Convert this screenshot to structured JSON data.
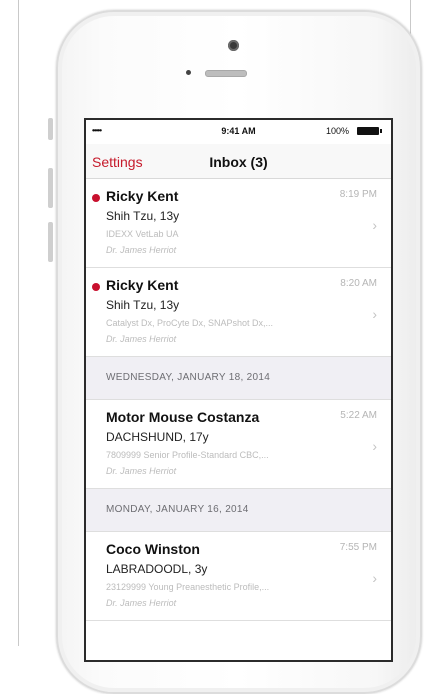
{
  "status_bar": {
    "signal": "•••••",
    "time": "9:41 AM",
    "battery": "100%"
  },
  "nav": {
    "back_label": "Settings",
    "title": "Inbox (3)"
  },
  "messages": [
    {
      "name": "Ricky Kent",
      "breed": "Shih Tzu,  13y",
      "tests": "IDEXX VetLab UA",
      "doctor": "Dr. James Herriot",
      "time": "8:19 PM",
      "unread": true
    },
    {
      "name": "Ricky Kent",
      "breed": "Shih Tzu,  13y",
      "tests": "Catalyst Dx, ProCyte Dx, SNAPshot Dx,...",
      "doctor": "Dr. James Herriot",
      "time": "8:20 AM",
      "unread": true
    },
    {
      "section": "WEDNESDAY, JANUARY 18, 2014",
      "name": "Motor Mouse Costanza",
      "breed": "DACHSHUND,  17y",
      "tests": "7809999 Senior Profile-Standard CBC,...",
      "doctor": "Dr. James Herriot",
      "time": "5:22 AM",
      "unread": false
    },
    {
      "section": "MONDAY, JANUARY 16, 2014",
      "name": "Coco Winston",
      "breed": "LABRADOODL,  3y",
      "tests": "23129999 Young Preanesthetic Profile,...",
      "doctor": "Dr. James Herriot",
      "time": "7:55 PM",
      "unread": false
    }
  ],
  "colors": {
    "accent": "#c61a2b",
    "unread_dot": "#c8102e",
    "section_bg": "#f0eff4"
  },
  "icons": {
    "chevron": "›"
  }
}
